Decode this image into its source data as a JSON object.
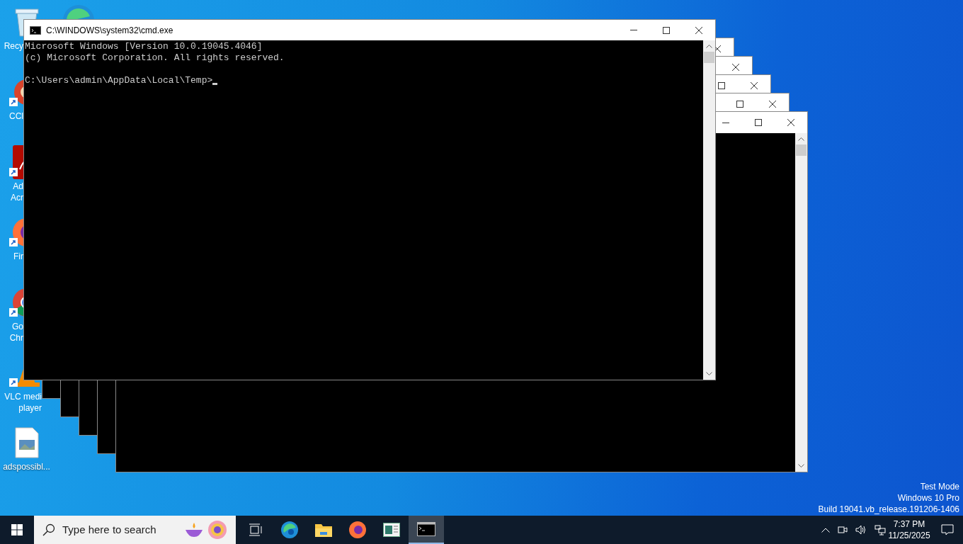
{
  "desktop_icons": [
    {
      "kind": "recycle-bin",
      "labels": [
        "Recy"
      ],
      "cut": true,
      "shortcut": false
    },
    {
      "kind": "cleaner",
      "labels": [
        "CCl"
      ],
      "cut": true,
      "shortcut": true
    },
    {
      "kind": "acrobat",
      "labels": [
        "Ad",
        "Acr"
      ],
      "cut": true,
      "shortcut": true
    },
    {
      "kind": "firefox",
      "labels": [
        "Fir"
      ],
      "cut": true,
      "shortcut": true
    },
    {
      "kind": "chrome",
      "labels": [
        "Go",
        "Chr"
      ],
      "cut": true,
      "shortcut": true
    },
    {
      "kind": "vlc",
      "labels": [
        "VLC medi",
        "player"
      ],
      "cut": true,
      "shortcut": true
    },
    {
      "kind": "image-file",
      "labels": [
        "adspossibl..."
      ],
      "cut": false,
      "shortcut": false
    }
  ],
  "background_windows": [
    {
      "kind": "console"
    },
    {
      "kind": "console"
    },
    {
      "kind": "console"
    },
    {
      "kind": "console"
    },
    {
      "kind": "console"
    }
  ],
  "main_window": {
    "title": "C:\\WINDOWS\\system32\\cmd.exe",
    "lines": [
      "Microsoft Windows [Version 10.0.19045.4046]",
      "(c) Microsoft Corporation. All rights reserved."
    ],
    "prompt": "C:\\Users\\admin\\AppData\\Local\\Temp>",
    "cursor": true
  },
  "system_watermark": [
    "Test Mode",
    "Windows 10 Pro",
    "Build 19041.vb_release.191206-1406"
  ],
  "taskbar": {
    "search": {
      "placeholder": "Type here to search"
    },
    "apps": [
      {
        "kind": "task-view",
        "active": false
      },
      {
        "kind": "edge",
        "active": false
      },
      {
        "kind": "explorer",
        "active": false
      },
      {
        "kind": "firefox",
        "active": false
      },
      {
        "kind": "app",
        "active": false
      },
      {
        "kind": "cmd",
        "active": true
      }
    ],
    "time": "7:37 PM",
    "date": "11/25/2025"
  }
}
